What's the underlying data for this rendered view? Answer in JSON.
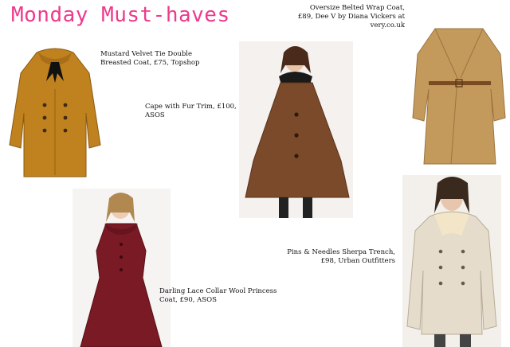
{
  "title": "Monday Must-haves",
  "items": [
    {
      "caption": "Mustard Velvet Tie Double Breasted Coat, £75, Topshop"
    },
    {
      "caption": "Cape with Fur Trim, £100, ASOS"
    },
    {
      "caption": "Oversize Belted Wrap Coat, £89, Dee V by Diana Vickers at very.co.uk"
    },
    {
      "caption": "Darling Lace Collar Wool Princess Coat, £90, ASOS"
    },
    {
      "caption": "Pins & Needles Sherpa Trench, £98, Urban Outfitters"
    }
  ],
  "colors": {
    "title": "#ee3a8c",
    "mustard": "#c0811f",
    "cape": "#7a4a2a",
    "camel": "#c49a5c",
    "burgundy": "#7a1a24",
    "cream": "#e6dccb"
  }
}
